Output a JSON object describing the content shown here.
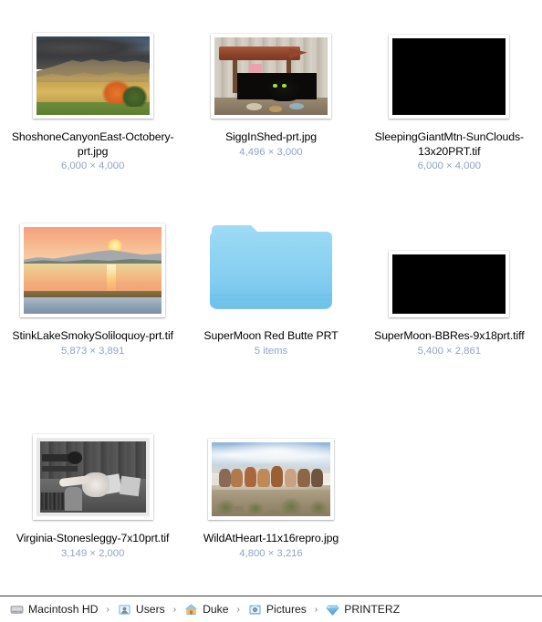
{
  "window": {
    "view": "icon-view",
    "background_color": "#ffffff"
  },
  "items": [
    {
      "name": "ShoshoneCanyonEast-Octobery-prt.jpg",
      "meta": "6,000 × 4,000",
      "kind": "image",
      "thumb": "autumn-mountain-landscape"
    },
    {
      "name": "SiggInShed-prt.jpg",
      "meta": "4,496 × 3,000",
      "kind": "image",
      "thumb": "black-cat-in-weathered-shed"
    },
    {
      "name": "SleepingGiantMtn-SunClouds-13x20PRT.tif",
      "meta": "6,000 × 4,000",
      "kind": "image",
      "thumb": "black-preview"
    },
    {
      "name": "StinkLakeSmokySoliloquoy-prt.tif",
      "meta": "5,873 × 3,891",
      "kind": "image",
      "thumb": "lake-sunset"
    },
    {
      "name": "SuperMoon Red Butte PRT",
      "meta": "5 items",
      "kind": "folder",
      "thumb": "blue-folder"
    },
    {
      "name": "SuperMoon-BBRes-9x18prt.tiff",
      "meta": "5,400 × 2,861",
      "kind": "image",
      "thumb": "black-preview"
    },
    {
      "name": "Virginia-Stonesleggy-7x10prt.tif",
      "meta": "3,149 × 2,000",
      "kind": "image",
      "thumb": "black-and-white-interior-portrait"
    },
    {
      "name": "WildAtHeart-11x16repro.jpg",
      "meta": "4,800 × 3,216",
      "kind": "image",
      "thumb": "running-horses"
    }
  ],
  "path_bar": {
    "separator": "›",
    "crumbs": [
      {
        "label": "Macintosh HD",
        "icon": "hard-drive-icon"
      },
      {
        "label": "Users",
        "icon": "users-folder-icon"
      },
      {
        "label": "Duke",
        "icon": "home-folder-icon"
      },
      {
        "label": "Pictures",
        "icon": "pictures-folder-icon"
      },
      {
        "label": "PRINTERZ",
        "icon": "blue-gem-folder-icon"
      }
    ]
  },
  "colors": {
    "label_text": "#000000",
    "meta_text": "#8fa4c4",
    "path_text": "#1a1a1a",
    "folder_blue": "#7ecbf0",
    "divider": "#3a3a3a"
  }
}
